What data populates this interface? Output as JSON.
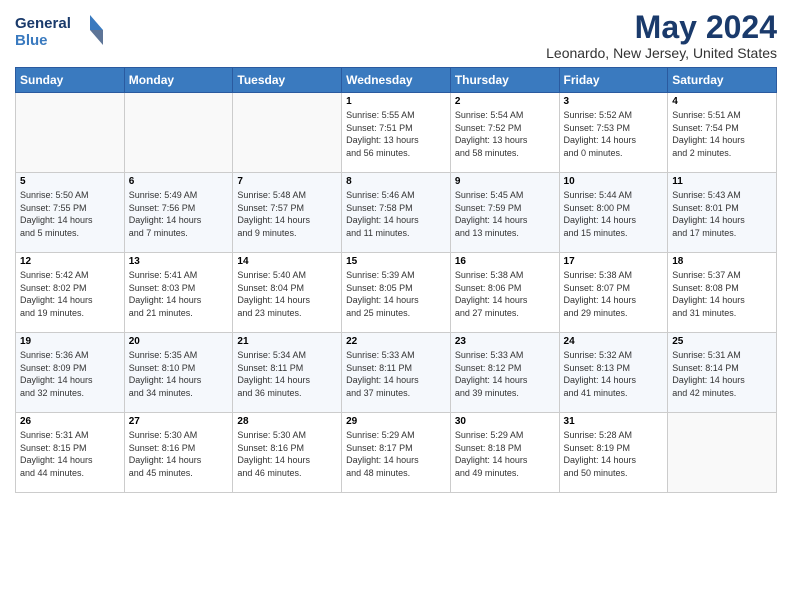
{
  "header": {
    "logo_line1": "General",
    "logo_line2": "Blue",
    "title": "May 2024",
    "subtitle": "Leonardo, New Jersey, United States"
  },
  "weekdays": [
    "Sunday",
    "Monday",
    "Tuesday",
    "Wednesday",
    "Thursday",
    "Friday",
    "Saturday"
  ],
  "weeks": [
    [
      {
        "day": "",
        "info": ""
      },
      {
        "day": "",
        "info": ""
      },
      {
        "day": "",
        "info": ""
      },
      {
        "day": "1",
        "info": "Sunrise: 5:55 AM\nSunset: 7:51 PM\nDaylight: 13 hours\nand 56 minutes."
      },
      {
        "day": "2",
        "info": "Sunrise: 5:54 AM\nSunset: 7:52 PM\nDaylight: 13 hours\nand 58 minutes."
      },
      {
        "day": "3",
        "info": "Sunrise: 5:52 AM\nSunset: 7:53 PM\nDaylight: 14 hours\nand 0 minutes."
      },
      {
        "day": "4",
        "info": "Sunrise: 5:51 AM\nSunset: 7:54 PM\nDaylight: 14 hours\nand 2 minutes."
      }
    ],
    [
      {
        "day": "5",
        "info": "Sunrise: 5:50 AM\nSunset: 7:55 PM\nDaylight: 14 hours\nand 5 minutes."
      },
      {
        "day": "6",
        "info": "Sunrise: 5:49 AM\nSunset: 7:56 PM\nDaylight: 14 hours\nand 7 minutes."
      },
      {
        "day": "7",
        "info": "Sunrise: 5:48 AM\nSunset: 7:57 PM\nDaylight: 14 hours\nand 9 minutes."
      },
      {
        "day": "8",
        "info": "Sunrise: 5:46 AM\nSunset: 7:58 PM\nDaylight: 14 hours\nand 11 minutes."
      },
      {
        "day": "9",
        "info": "Sunrise: 5:45 AM\nSunset: 7:59 PM\nDaylight: 14 hours\nand 13 minutes."
      },
      {
        "day": "10",
        "info": "Sunrise: 5:44 AM\nSunset: 8:00 PM\nDaylight: 14 hours\nand 15 minutes."
      },
      {
        "day": "11",
        "info": "Sunrise: 5:43 AM\nSunset: 8:01 PM\nDaylight: 14 hours\nand 17 minutes."
      }
    ],
    [
      {
        "day": "12",
        "info": "Sunrise: 5:42 AM\nSunset: 8:02 PM\nDaylight: 14 hours\nand 19 minutes."
      },
      {
        "day": "13",
        "info": "Sunrise: 5:41 AM\nSunset: 8:03 PM\nDaylight: 14 hours\nand 21 minutes."
      },
      {
        "day": "14",
        "info": "Sunrise: 5:40 AM\nSunset: 8:04 PM\nDaylight: 14 hours\nand 23 minutes."
      },
      {
        "day": "15",
        "info": "Sunrise: 5:39 AM\nSunset: 8:05 PM\nDaylight: 14 hours\nand 25 minutes."
      },
      {
        "day": "16",
        "info": "Sunrise: 5:38 AM\nSunset: 8:06 PM\nDaylight: 14 hours\nand 27 minutes."
      },
      {
        "day": "17",
        "info": "Sunrise: 5:38 AM\nSunset: 8:07 PM\nDaylight: 14 hours\nand 29 minutes."
      },
      {
        "day": "18",
        "info": "Sunrise: 5:37 AM\nSunset: 8:08 PM\nDaylight: 14 hours\nand 31 minutes."
      }
    ],
    [
      {
        "day": "19",
        "info": "Sunrise: 5:36 AM\nSunset: 8:09 PM\nDaylight: 14 hours\nand 32 minutes."
      },
      {
        "day": "20",
        "info": "Sunrise: 5:35 AM\nSunset: 8:10 PM\nDaylight: 14 hours\nand 34 minutes."
      },
      {
        "day": "21",
        "info": "Sunrise: 5:34 AM\nSunset: 8:11 PM\nDaylight: 14 hours\nand 36 minutes."
      },
      {
        "day": "22",
        "info": "Sunrise: 5:33 AM\nSunset: 8:11 PM\nDaylight: 14 hours\nand 37 minutes."
      },
      {
        "day": "23",
        "info": "Sunrise: 5:33 AM\nSunset: 8:12 PM\nDaylight: 14 hours\nand 39 minutes."
      },
      {
        "day": "24",
        "info": "Sunrise: 5:32 AM\nSunset: 8:13 PM\nDaylight: 14 hours\nand 41 minutes."
      },
      {
        "day": "25",
        "info": "Sunrise: 5:31 AM\nSunset: 8:14 PM\nDaylight: 14 hours\nand 42 minutes."
      }
    ],
    [
      {
        "day": "26",
        "info": "Sunrise: 5:31 AM\nSunset: 8:15 PM\nDaylight: 14 hours\nand 44 minutes."
      },
      {
        "day": "27",
        "info": "Sunrise: 5:30 AM\nSunset: 8:16 PM\nDaylight: 14 hours\nand 45 minutes."
      },
      {
        "day": "28",
        "info": "Sunrise: 5:30 AM\nSunset: 8:16 PM\nDaylight: 14 hours\nand 46 minutes."
      },
      {
        "day": "29",
        "info": "Sunrise: 5:29 AM\nSunset: 8:17 PM\nDaylight: 14 hours\nand 48 minutes."
      },
      {
        "day": "30",
        "info": "Sunrise: 5:29 AM\nSunset: 8:18 PM\nDaylight: 14 hours\nand 49 minutes."
      },
      {
        "day": "31",
        "info": "Sunrise: 5:28 AM\nSunset: 8:19 PM\nDaylight: 14 hours\nand 50 minutes."
      },
      {
        "day": "",
        "info": ""
      }
    ]
  ]
}
